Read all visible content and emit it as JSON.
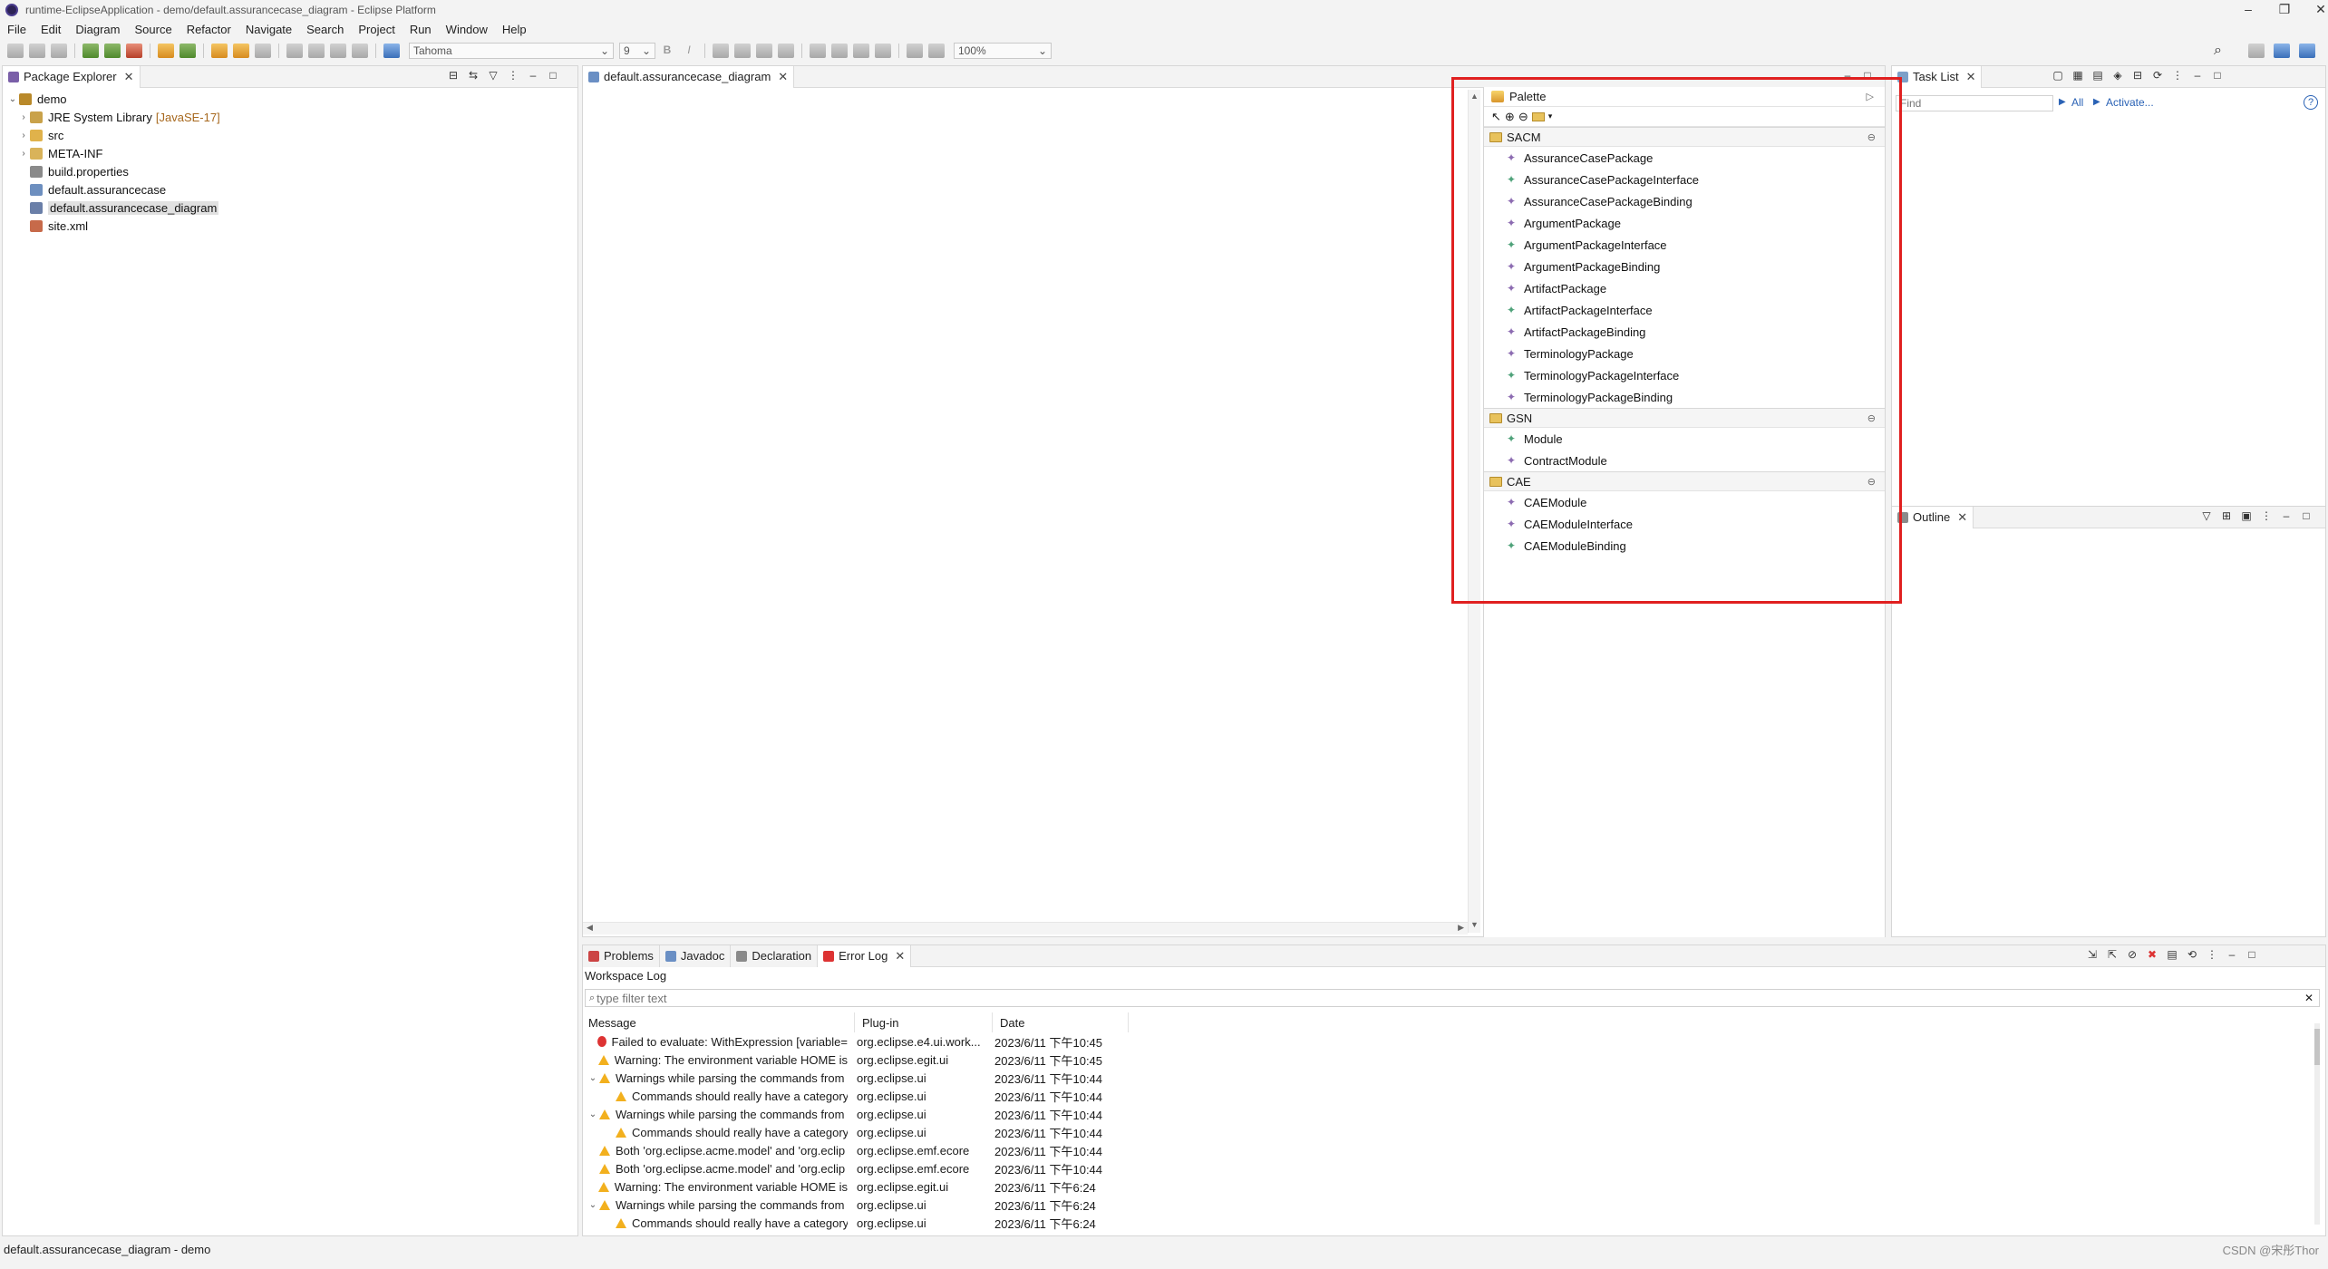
{
  "window": {
    "title": "runtime-EclipseApplication - demo/default.assurancecase_diagram - Eclipse Platform"
  },
  "menu": [
    "File",
    "Edit",
    "Diagram",
    "Source",
    "Refactor",
    "Navigate",
    "Search",
    "Project",
    "Run",
    "Window",
    "Help"
  ],
  "toolbar": {
    "font_combo": "Tahoma",
    "size_combo": "9",
    "zoom_combo": "100%"
  },
  "package_explorer": {
    "tab_label": "Package Explorer",
    "items": [
      {
        "label": "demo",
        "level": 0,
        "expanded": true
      },
      {
        "label": "JRE System Library",
        "decoration": "[JavaSE-17]",
        "level": 1
      },
      {
        "label": "src",
        "level": 1
      },
      {
        "label": "META-INF",
        "level": 1
      },
      {
        "label": "build.properties",
        "level": 1
      },
      {
        "label": "default.assurancecase",
        "level": 1
      },
      {
        "label": "default.assurancecase_diagram",
        "level": 1,
        "selected": true
      },
      {
        "label": "site.xml",
        "level": 1
      }
    ]
  },
  "editor": {
    "tab_label": "default.assurancecase_diagram"
  },
  "palette": {
    "title": "Palette",
    "drawers": [
      {
        "name": "SACM",
        "items": [
          "AssuranceCasePackage",
          "AssuranceCasePackageInterface",
          "AssuranceCasePackageBinding",
          "ArgumentPackage",
          "ArgumentPackageInterface",
          "ArgumentPackageBinding",
          "ArtifactPackage",
          "ArtifactPackageInterface",
          "ArtifactPackageBinding",
          "TerminologyPackage",
          "TerminologyPackageInterface",
          "TerminologyPackageBinding"
        ]
      },
      {
        "name": "GSN",
        "items": [
          "Module",
          "ContractModule"
        ]
      },
      {
        "name": "CAE",
        "items": [
          "CAEModule",
          "CAEModuleInterface",
          "CAEModuleBinding"
        ]
      }
    ]
  },
  "task_list": {
    "tab_label": "Task List",
    "find_placeholder": "Find",
    "all_label": "All",
    "activate_label": "Activate..."
  },
  "outline": {
    "tab_label": "Outline"
  },
  "bottom": {
    "tabs": [
      "Problems",
      "Javadoc",
      "Declaration",
      "Error Log"
    ],
    "subtitle": "Workspace Log",
    "filter_placeholder": "type filter text",
    "columns": [
      "Message",
      "Plug-in",
      "Date"
    ],
    "rows": [
      {
        "kind": "error",
        "indent": 0,
        "expander": "",
        "message": "Failed to evaluate: WithExpression [variable=",
        "plugin": "org.eclipse.e4.ui.work...",
        "date": "2023/6/11 下午10:45"
      },
      {
        "kind": "warn",
        "indent": 0,
        "expander": "",
        "message": "Warning: The environment variable HOME is",
        "plugin": "org.eclipse.egit.ui",
        "date": "2023/6/11 下午10:45"
      },
      {
        "kind": "warn",
        "indent": 0,
        "expander": "v",
        "message": "Warnings while parsing the commands from",
        "plugin": "org.eclipse.ui",
        "date": "2023/6/11 下午10:44"
      },
      {
        "kind": "warn",
        "indent": 1,
        "expander": "",
        "message": "Commands should really have a category:",
        "plugin": "org.eclipse.ui",
        "date": "2023/6/11 下午10:44"
      },
      {
        "kind": "warn",
        "indent": 0,
        "expander": "v",
        "message": "Warnings while parsing the commands from",
        "plugin": "org.eclipse.ui",
        "date": "2023/6/11 下午10:44"
      },
      {
        "kind": "warn",
        "indent": 1,
        "expander": "",
        "message": "Commands should really have a category:",
        "plugin": "org.eclipse.ui",
        "date": "2023/6/11 下午10:44"
      },
      {
        "kind": "warn",
        "indent": 0,
        "expander": "",
        "message": "Both 'org.eclipse.acme.model' and 'org.eclip",
        "plugin": "org.eclipse.emf.ecore",
        "date": "2023/6/11 下午10:44"
      },
      {
        "kind": "warn",
        "indent": 0,
        "expander": "",
        "message": "Both 'org.eclipse.acme.model' and 'org.eclip",
        "plugin": "org.eclipse.emf.ecore",
        "date": "2023/6/11 下午10:44"
      },
      {
        "kind": "warn",
        "indent": 0,
        "expander": "",
        "message": "Warning: The environment variable HOME is",
        "plugin": "org.eclipse.egit.ui",
        "date": "2023/6/11 下午6:24"
      },
      {
        "kind": "warn",
        "indent": 0,
        "expander": "v",
        "message": "Warnings while parsing the commands from",
        "plugin": "org.eclipse.ui",
        "date": "2023/6/11 下午6:24"
      },
      {
        "kind": "warn",
        "indent": 1,
        "expander": "",
        "message": "Commands should really have a category:",
        "plugin": "org.eclipse.ui",
        "date": "2023/6/11 下午6:24"
      }
    ]
  },
  "status": {
    "left": "default.assurancecase_diagram - demo",
    "watermark": "CSDN @宋彤Thor"
  },
  "colors": {
    "highlight": "#e02020",
    "decoration": "#a7681e"
  }
}
